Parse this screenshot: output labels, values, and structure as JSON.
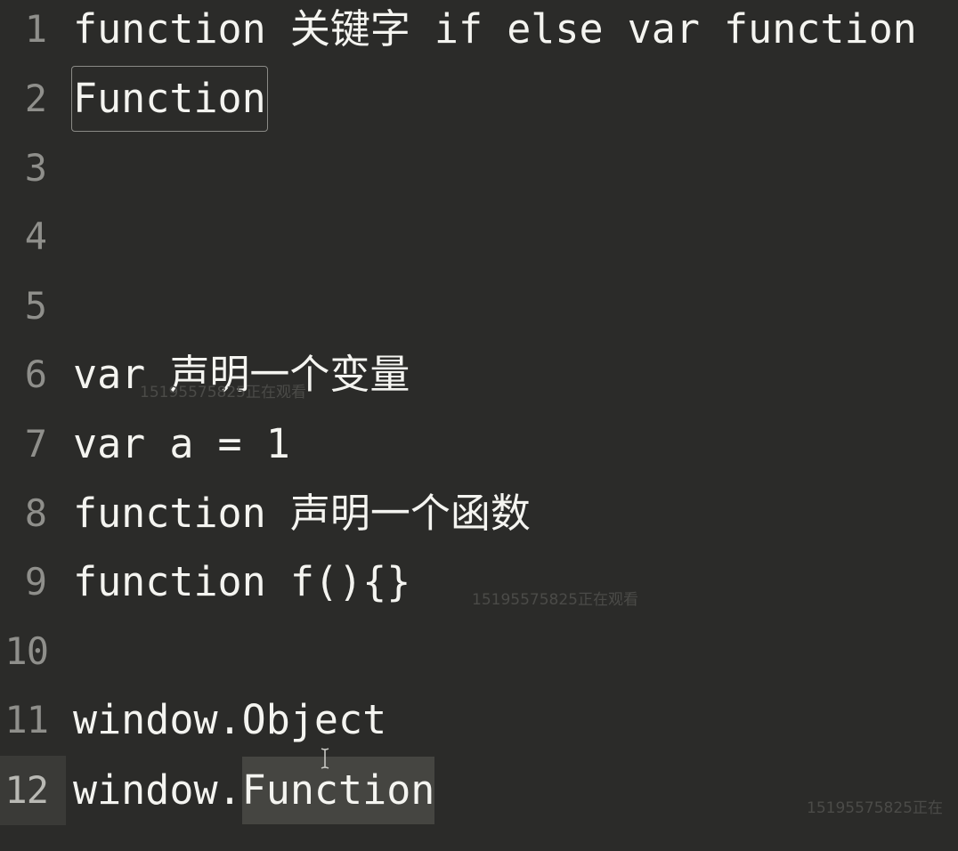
{
  "editor": {
    "lines": [
      {
        "number": "1",
        "text": "function 关键字 if else var function"
      },
      {
        "number": "2",
        "text": "Function"
      },
      {
        "number": "3",
        "text": ""
      },
      {
        "number": "4",
        "text": ""
      },
      {
        "number": "5",
        "text": ""
      },
      {
        "number": "6",
        "text": "var 声明一个变量"
      },
      {
        "number": "7",
        "text": "var a = 1"
      },
      {
        "number": "8",
        "text": "function 声明一个函数"
      },
      {
        "number": "9",
        "text": "function f(){}"
      },
      {
        "number": "10",
        "text": ""
      },
      {
        "number": "11",
        "text": "window.Object"
      },
      {
        "number": "12",
        "text_prefix": "window.",
        "text_selected": "Function"
      }
    ],
    "current_line": "12"
  },
  "watermarks": [
    {
      "text": "15195575825正在观看"
    },
    {
      "text": "15195575825正在观看"
    },
    {
      "text": "15195575825正在"
    }
  ],
  "colors": {
    "background": "#2b2b29",
    "text": "#f4f4f0",
    "line_number": "#8f8f8b",
    "current_line_gutter": "#3a3a37",
    "selection": "#454541"
  },
  "icons": {
    "cursor": "i-beam-cursor-icon"
  }
}
